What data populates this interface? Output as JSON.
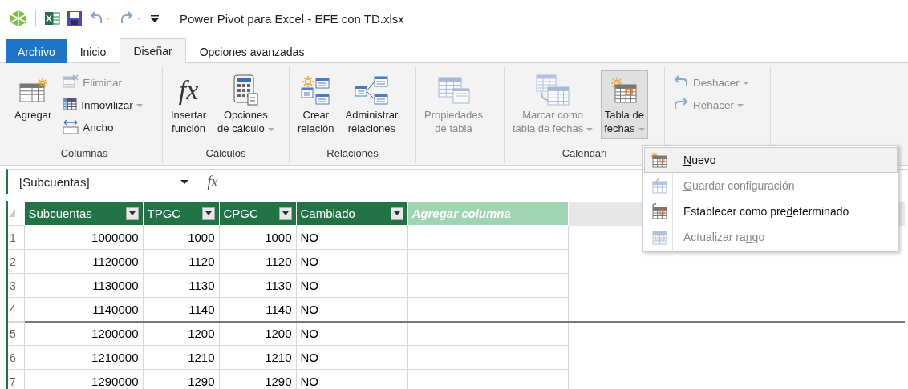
{
  "window": {
    "title": "Power Pivot para Excel - EFE con TD.xlsx"
  },
  "tabs": [
    {
      "label": "Archivo",
      "kind": "file",
      "selected": false
    },
    {
      "label": "Inicio",
      "kind": "tab",
      "selected": false
    },
    {
      "label": "Diseñar",
      "kind": "tab",
      "selected": true
    },
    {
      "label": "Opciones avanzadas",
      "kind": "tab",
      "selected": false
    }
  ],
  "ribbon": {
    "groups": [
      {
        "label": "Columnas",
        "items": [
          {
            "kind": "large",
            "lines": [
              "Agregar"
            ],
            "disabled": false,
            "dropdown": false,
            "pressed": false
          },
          {
            "kind": "small",
            "lines": [
              "Eliminar"
            ],
            "disabled": true,
            "dropdown": false,
            "pressed": false
          },
          {
            "kind": "small",
            "lines": [
              "Inmovilizar"
            ],
            "disabled": false,
            "dropdown": true,
            "pressed": false
          },
          {
            "kind": "small",
            "lines": [
              "Ancho"
            ],
            "disabled": false,
            "dropdown": false,
            "pressed": false
          }
        ]
      },
      {
        "label": "Cálculos",
        "items": [
          {
            "kind": "large",
            "lines": [
              "Insertar",
              "función"
            ],
            "symbol": "fx",
            "disabled": false,
            "dropdown": false,
            "pressed": false
          },
          {
            "kind": "large",
            "lines": [
              "Opciones",
              "de cálculo"
            ],
            "disabled": false,
            "dropdown": true,
            "pressed": false
          }
        ]
      },
      {
        "label": "Relaciones",
        "items": [
          {
            "kind": "large",
            "lines": [
              "Crear",
              "relación"
            ],
            "disabled": false,
            "dropdown": false,
            "pressed": false
          },
          {
            "kind": "large",
            "lines": [
              "Administrar",
              "relaciones"
            ],
            "disabled": false,
            "dropdown": false,
            "pressed": false
          }
        ]
      },
      {
        "items": [
          {
            "kind": "large",
            "lines": [
              "Propiedades",
              "de tabla"
            ],
            "disabled": true,
            "dropdown": false,
            "pressed": false
          }
        ]
      },
      {
        "label": "Calendari",
        "items": [
          {
            "kind": "large",
            "lines": [
              "Marcar como",
              "tabla de fechas"
            ],
            "disabled": true,
            "dropdown": true,
            "pressed": false
          },
          {
            "kind": "large",
            "lines": [
              "Tabla de",
              "fechas"
            ],
            "disabled": false,
            "dropdown": true,
            "pressed": true
          }
        ]
      },
      {
        "items": [
          {
            "kind": "small",
            "lines": [
              "Deshacer"
            ],
            "disabled": true,
            "dropdown": true,
            "pressed": false
          },
          {
            "kind": "small",
            "lines": [
              "Rehacer"
            ],
            "disabled": true,
            "dropdown": true,
            "pressed": false
          }
        ]
      }
    ]
  },
  "formula_bar": {
    "name_box": "[Subcuentas]",
    "function_label": "fx"
  },
  "table": {
    "columns": [
      {
        "label": "Subcuentas",
        "kind": "number"
      },
      {
        "label": "TPGC",
        "kind": "number"
      },
      {
        "label": "CPGC",
        "kind": "number"
      },
      {
        "label": "Cambiado",
        "kind": "text"
      },
      {
        "label": "Agregar columna",
        "kind": "add"
      }
    ],
    "rows": [
      {
        "number": "1",
        "cells": [
          "1000000",
          "1000",
          "1000",
          "NO"
        ],
        "separator_below": false
      },
      {
        "number": "2",
        "cells": [
          "1120000",
          "1120",
          "1120",
          "NO"
        ],
        "separator_below": false
      },
      {
        "number": "3",
        "cells": [
          "1130000",
          "1130",
          "1130",
          "NO"
        ],
        "separator_below": false
      },
      {
        "number": "4",
        "cells": [
          "1140000",
          "1140",
          "1140",
          "NO"
        ],
        "separator_below": true
      },
      {
        "number": "5",
        "cells": [
          "1200000",
          "1200",
          "1200",
          "NO"
        ],
        "separator_below": false
      },
      {
        "number": "6",
        "cells": [
          "1210000",
          "1210",
          "1210",
          "NO"
        ],
        "separator_below": false
      },
      {
        "number": "7",
        "cells": [
          "1290000",
          "1290",
          "1290",
          "NO"
        ],
        "separator_below": false
      }
    ]
  },
  "dropdown_menu": {
    "items": [
      {
        "access_key": "N",
        "label_after": "uevo",
        "selected": true,
        "disabled": false
      },
      {
        "access_key": "G",
        "label_after": "uardar configuración",
        "selected": false,
        "disabled": true
      },
      {
        "label_before": "Establecer como pre",
        "access_key": "d",
        "label_after": "eterminado",
        "selected": false,
        "disabled": false
      },
      {
        "label_before": "Actualizar ra",
        "access_key": "n",
        "label_after": "go",
        "selected": false,
        "disabled": true
      }
    ]
  }
}
